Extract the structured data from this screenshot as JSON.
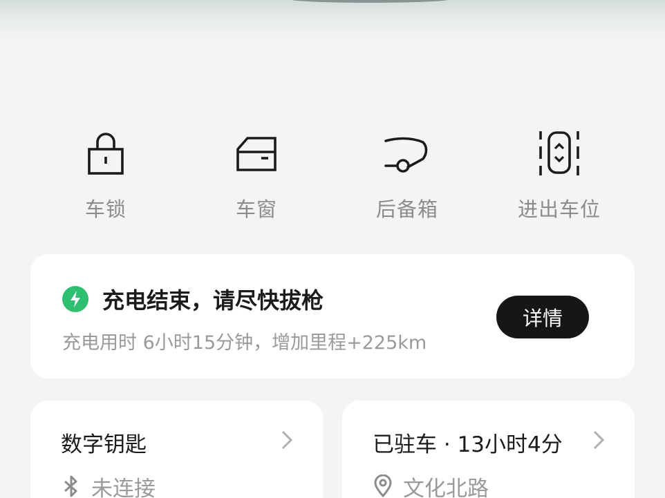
{
  "controls": [
    {
      "label": "车锁",
      "icon": "lock-icon"
    },
    {
      "label": "车窗",
      "icon": "car-window-icon"
    },
    {
      "label": "后备箱",
      "icon": "trunk-icon"
    },
    {
      "label": "进出车位",
      "icon": "parking-space-icon"
    }
  ],
  "charge": {
    "title": "充电结束，请尽快拔枪",
    "subtitle": "充电用时 6小时15分钟，增加里程+225km",
    "detail_label": "详情",
    "icon": "charging-bolt-icon",
    "accent_color": "#2fbf71"
  },
  "digital_key": {
    "title": "数字钥匙",
    "status": "未连接",
    "status_icon": "bluetooth-icon"
  },
  "parking": {
    "title": "已驻车 · 13小时4分",
    "location": "文化北路",
    "location_icon": "location-pin-icon"
  }
}
